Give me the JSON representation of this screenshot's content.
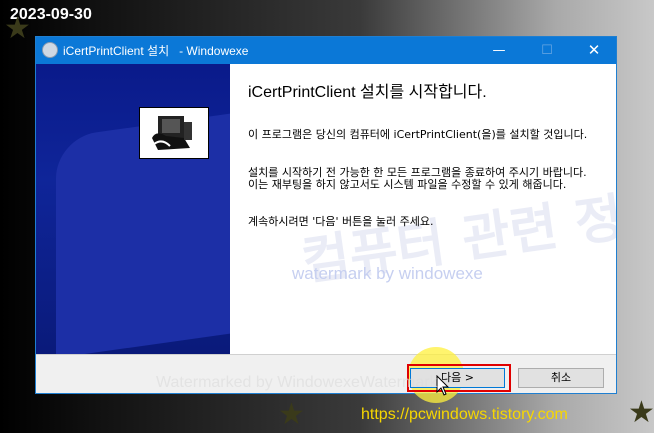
{
  "overlay": {
    "date": "2023-09-30",
    "url": "https://pcwindows.tistory.com",
    "watermark_bottom": "Watermarked by WindowexeWatermark",
    "watermark_center": "watermark by windowexe",
    "watermark_korean": "컴퓨터 관련 정보"
  },
  "window": {
    "title": "iCertPrintClient 설치   - Windowexe",
    "controls": {
      "minimize": "—",
      "maximize": "☐",
      "close": "✕"
    }
  },
  "content": {
    "heading": "iCertPrintClient 설치를 시작합니다.",
    "paragraph1": "이 프로그램은 당신의 컴퓨터에 iCertPrintClient(을)를 설치할 것입니다.",
    "paragraph2": "설치를 시작하기 전 가능한 한 모든 프로그램을 종료하여 주시기 바랍니다. 이는 재부팅을 하지 않고서도 시스템 파일을 수정할 수 있게 해줍니다.",
    "paragraph3": "계속하시려면 '다음' 버튼을 눌러 주세요."
  },
  "buttons": {
    "next": "다음 >",
    "cancel": "취소"
  },
  "colors": {
    "titlebar": "#0b78d7",
    "banner": "#0f2599",
    "highlight": "#e00000",
    "url": "#f7d700"
  }
}
